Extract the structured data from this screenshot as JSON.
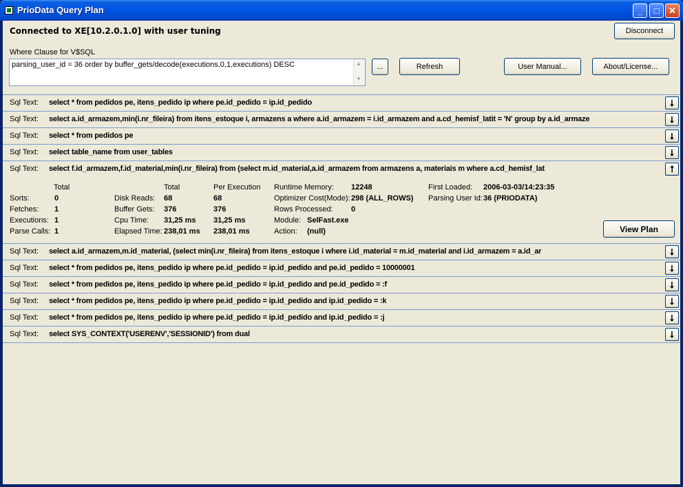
{
  "window": {
    "title": "PrioData Query Plan"
  },
  "header": {
    "connection": "Connected to XE[10.2.0.1.0] with user tuning",
    "disconnect": "Disconnect"
  },
  "where": {
    "label": "Where Clause for V$SQL",
    "value": "parsing_user_id = 36 order by buffer_gets/decode(executions,0,1,executions) DESC",
    "browse": "...",
    "refresh": "Refresh",
    "manual": "User Manual...",
    "about": "About/License..."
  },
  "sql_label": "Sql Text:",
  "sql_rows": [
    {
      "text": "select * from pedidos pe, itens_pedido ip where pe.id_pedido = ip.id_pedido",
      "arrow": "down"
    },
    {
      "text": "select a.id_armazem,min(i.nr_fileira) from itens_estoque i,      armazens a  where a.id_armazem = i.id_armazem and  a.cd_hemisf_latit = 'N' group by a.id_armaze",
      "arrow": "down"
    },
    {
      "text": "select * from pedidos pe",
      "arrow": "down"
    },
    {
      "text": "select table_name from user_tables",
      "arrow": "down"
    },
    {
      "text": "select f.id_armazem,f.id_material,min(i.nr_fileira) from (select m.id_material,a.id_armazem        from  armazens a,             materiais m         where   a.cd_hemisf_lat",
      "arrow": "up"
    },
    {
      "text": "select a.id_armazem,m.id_material,      (select min(i.nr_fileira)        from  itens_estoque i         where i.id_material = m.id_material         and  i.id_armazem =  a.id_ar",
      "arrow": "down"
    },
    {
      "text": "select * from pedidos pe, itens_pedido ip where pe.id_pedido = ip.id_pedido and pe.id_pedido = 10000001",
      "arrow": "down"
    },
    {
      "text": "select * from pedidos pe, itens_pedido ip where pe.id_pedido = ip.id_pedido and pe.id_pedido = :f",
      "arrow": "down"
    },
    {
      "text": "select * from pedidos pe, itens_pedido ip where pe.id_pedido = ip.id_pedido and ip.id_pedido = :k",
      "arrow": "down"
    },
    {
      "text": "select * from pedidos pe, itens_pedido ip where pe.id_pedido = ip.id_pedido and ip.id_pedido = :j",
      "arrow": "down"
    },
    {
      "text": "select SYS_CONTEXT('USERENV','SESSIONID') from dual",
      "arrow": "down"
    }
  ],
  "details": {
    "col_total": "Total",
    "col_total2": "Total",
    "col_per_exec": "Per Execution",
    "sorts_label": "Sorts:",
    "sorts": "0",
    "fetches_label": "Fetches:",
    "fetches": "1",
    "executions_label": "Executions:",
    "executions": "1",
    "parse_label": "Parse Calls:",
    "parse": "1",
    "disk_label": "Disk Reads:",
    "disk_total": "68",
    "disk_per": "68",
    "buffer_label": "Buffer Gets:",
    "buffer_total": "376",
    "buffer_per": "376",
    "cpu_label": "Cpu Time:",
    "cpu_total": "31,25 ms",
    "cpu_per": "31,25 ms",
    "elapsed_label": "Elapsed Time:",
    "elapsed_total": "238,01 ms",
    "elapsed_per": "238,01 ms",
    "mem_label": "Runtime Memory:",
    "mem": "12248",
    "cost_label": "Optimizer Cost(Mode):",
    "cost": "298 (ALL_ROWS)",
    "rows_label": "Rows Processed:",
    "rows": "0",
    "module_label": "Module:",
    "module": "SelFast.exe",
    "action_label": "Action:",
    "action": "(null)",
    "loaded_label": "First Loaded:",
    "loaded": "2006-03-03/14:23:35",
    "user_label": "Parsing User Id:",
    "user": "36 (PRIODATA)",
    "view_plan": "View Plan"
  },
  "icons": {
    "down": "arrow-down-icon",
    "up": "arrow-up-icon"
  }
}
